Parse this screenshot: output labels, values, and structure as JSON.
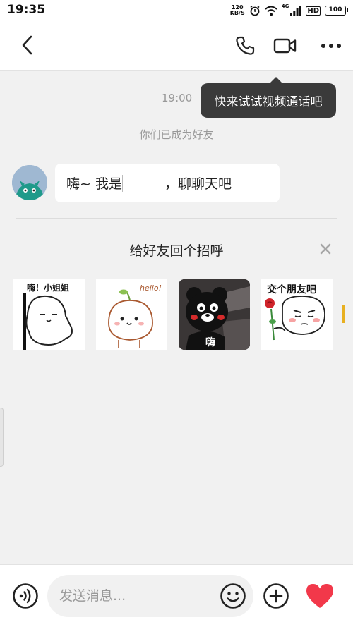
{
  "status_bar": {
    "time": "19:35",
    "net_speed_value": "120",
    "net_speed_unit": "KB/S",
    "network": "4G",
    "hd": "HD",
    "battery": "100"
  },
  "header": {
    "back_icon": "chevron-left-icon",
    "call_icon": "phone-icon",
    "video_icon": "video-camera-icon",
    "more_icon": "more-dots-icon"
  },
  "tooltip": {
    "text": "快来试试视频通话吧"
  },
  "chat": {
    "timestamp": "19:00",
    "system_message": "你们已成为好友",
    "message": {
      "text_before": "嗨~ 我是",
      "text_after": "，聊聊天吧"
    }
  },
  "greeting": {
    "title": "给好友回个招呼",
    "close_icon": "close-icon",
    "stickers": [
      {
        "caption": "嗨！小姐姐"
      },
      {
        "caption": "hello!"
      },
      {
        "caption": "嗨"
      },
      {
        "caption": "交个朋友吧"
      }
    ]
  },
  "input_bar": {
    "voice_icon": "voice-icon",
    "placeholder": "发送消息...",
    "emoji_icon": "emoji-icon",
    "add_icon": "plus-icon",
    "heart_icon": "heart-icon"
  },
  "colors": {
    "background": "#f1f1f1",
    "tooltip": "#3a3a3a",
    "heart": "#f2384a",
    "avatar": "#9fb8d2"
  }
}
